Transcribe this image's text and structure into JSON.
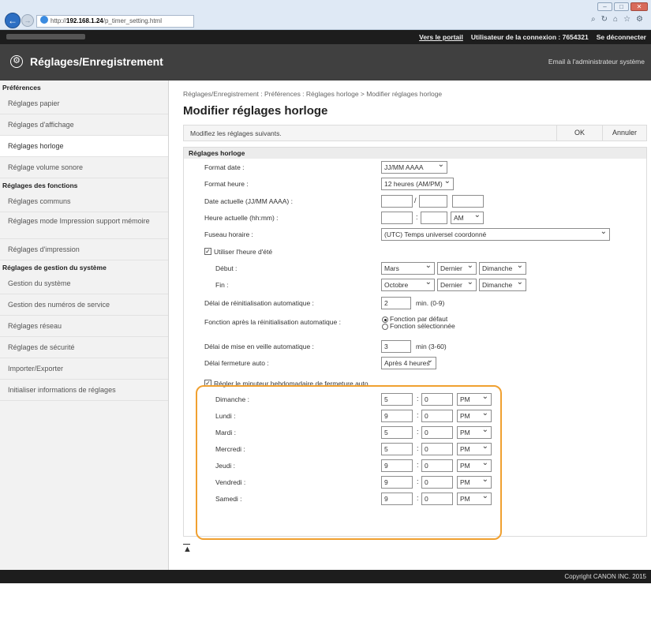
{
  "browser": {
    "url_prefix": "http://",
    "url_host": "192.168.1.24",
    "url_path": "/p_timer_setting.html",
    "toolbar_icons": [
      "search-icon",
      "refresh-icon",
      "home-icon",
      "star-icon",
      "gear-icon"
    ],
    "window_controls": [
      "–",
      "□",
      "✕"
    ]
  },
  "topbar": {
    "portal_link": "Vers le portail",
    "user_label": "Utilisateur de la connexion : ",
    "user_id": "7654321",
    "logout": "Se déconnecter"
  },
  "app": {
    "title": "Réglages/Enregistrement",
    "admin_mail": "Email à l'administrateur système"
  },
  "sidebar": {
    "preferences_title": "Préférences",
    "preferences_items": [
      "Réglages papier",
      "Réglages d'affichage",
      "Réglages horloge",
      "Réglage volume sonore"
    ],
    "functions_title": "Réglages des fonctions",
    "functions_items": [
      "Réglages communs",
      "Réglages mode Impression support mémoire",
      "Réglages d'impression"
    ],
    "system_title": "Réglages de gestion du système",
    "system_items": [
      "Gestion du système",
      "Gestion des numéros de service",
      "Réglages réseau",
      "Réglages de sécurité",
      "Importer/Exporter",
      "Initialiser informations de réglages"
    ]
  },
  "main": {
    "breadcrumb": "Réglages/Enregistrement : Préférences : Réglages horloge > Modifier réglages horloge",
    "title": "Modifier réglages horloge",
    "description": "Modifiez les réglages suivants.",
    "ok_button": "OK",
    "cancel_button": "Annuler",
    "section_title": "Réglages horloge",
    "date_format": {
      "label": "Format date :",
      "value": "JJ/MM AAAA"
    },
    "time_format": {
      "label": "Format heure :",
      "value": "12 heures (AM/PM)"
    },
    "current_date": {
      "label": "Date actuelle (JJ/MM AAAA) :",
      "sep": "/"
    },
    "current_time": {
      "label": "Heure actuelle (hh:mm) :",
      "sep": ":",
      "ampm": "AM"
    },
    "timezone": {
      "label": "Fuseau horaire :",
      "value": "(UTC) Temps universel coordonné"
    },
    "dst": {
      "label": "Utiliser l'heure d'été",
      "start_label": "Début :",
      "start_month": "Mars",
      "start_week": "Dernier",
      "start_day": "Dimanche",
      "end_label": "Fin :",
      "end_month": "Octobre",
      "end_week": "Dernier",
      "end_day": "Dimanche"
    },
    "auto_reset": {
      "label": "Délai de réinitialisation automatique :",
      "value": "2",
      "suffix": "min. (0-9)"
    },
    "after_reset": {
      "label": "Fonction après la réinitialisation automatique :",
      "option_default": "Fonction par défaut",
      "option_selected": "Fonction sélectionnée"
    },
    "sleep": {
      "label": "Délai de mise en veille automatique :",
      "value": "3",
      "suffix": "min (3-60)"
    },
    "auto_off": {
      "label": "Délai fermeture auto :",
      "value": "Après 4 heures"
    },
    "weekly_timer": {
      "label": "Régler le minuteur hebdomadaire de fermeture auto",
      "days": [
        {
          "day": "Dimanche :",
          "hour": "5",
          "minute": "0",
          "ampm": "PM"
        },
        {
          "day": "Lundi :",
          "hour": "9",
          "minute": "0",
          "ampm": "PM"
        },
        {
          "day": "Mardi :",
          "hour": "5",
          "minute": "0",
          "ampm": "PM"
        },
        {
          "day": "Mercredi :",
          "hour": "5",
          "minute": "0",
          "ampm": "PM"
        },
        {
          "day": "Jeudi :",
          "hour": "9",
          "minute": "0",
          "ampm": "PM"
        },
        {
          "day": "Vendredi :",
          "hour": "9",
          "minute": "0",
          "ampm": "PM"
        },
        {
          "day": "Samedi :",
          "hour": "9",
          "minute": "0",
          "ampm": "PM"
        }
      ]
    },
    "to_top": "⯭"
  },
  "footer": {
    "copyright": "Copyright CANON INC. 2015"
  },
  "colors": {
    "highlight": "#f0a030",
    "titlebar": "#404040",
    "topbar": "#1d1d1d"
  }
}
